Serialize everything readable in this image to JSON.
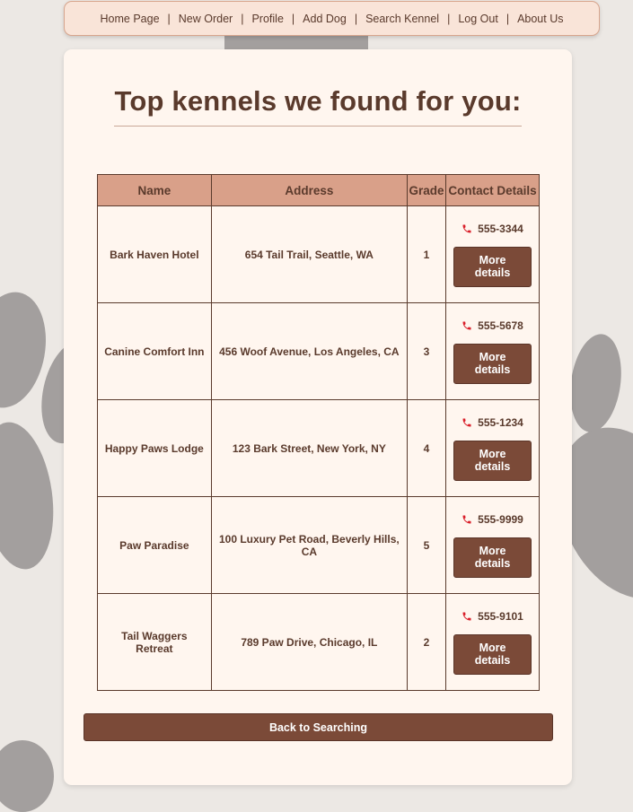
{
  "nav": {
    "items": [
      {
        "label": "Home Page"
      },
      {
        "label": "New Order"
      },
      {
        "label": "Profile"
      },
      {
        "label": "Add Dog"
      },
      {
        "label": "Search Kennel"
      },
      {
        "label": "Log Out"
      },
      {
        "label": "About Us"
      }
    ],
    "separator": "|"
  },
  "page": {
    "title": "Top kennels we found for you:"
  },
  "table": {
    "headers": {
      "name": "Name",
      "address": "Address",
      "grade": "Grade",
      "contact": "Contact Details"
    },
    "rows": [
      {
        "name": "Bark Haven Hotel",
        "address": "654 Tail Trail, Seattle, WA",
        "grade": "1",
        "phone": "555-3344",
        "button": "More details"
      },
      {
        "name": "Canine Comfort Inn",
        "address": "456 Woof Avenue, Los Angeles, CA",
        "grade": "3",
        "phone": "555-5678",
        "button": "More details"
      },
      {
        "name": "Happy Paws Lodge",
        "address": "123 Bark Street, New York, NY",
        "grade": "4",
        "phone": "555-1234",
        "button": "More details"
      },
      {
        "name": "Paw Paradise",
        "address": "100 Luxury Pet Road, Beverly Hills, CA",
        "grade": "5",
        "phone": "555-9999",
        "button": "More details"
      },
      {
        "name": "Tail Waggers Retreat",
        "address": "789 Paw Drive, Chicago, IL",
        "grade": "2",
        "phone": "555-9101",
        "button": "More details"
      }
    ]
  },
  "actions": {
    "back_label": "Back to Searching"
  },
  "icons": {
    "phone": "phone-icon",
    "background": "paw-print-icon"
  },
  "colors": {
    "background": "#ece8e4",
    "paw": "#a39f9e",
    "nav_bg": "#f9e4d8",
    "card_bg": "#fff6ef",
    "header_bg": "#d9a089",
    "button_bg": "#7b4a38",
    "text": "#5a3a2c",
    "phone_icon": "#d91f2a"
  }
}
